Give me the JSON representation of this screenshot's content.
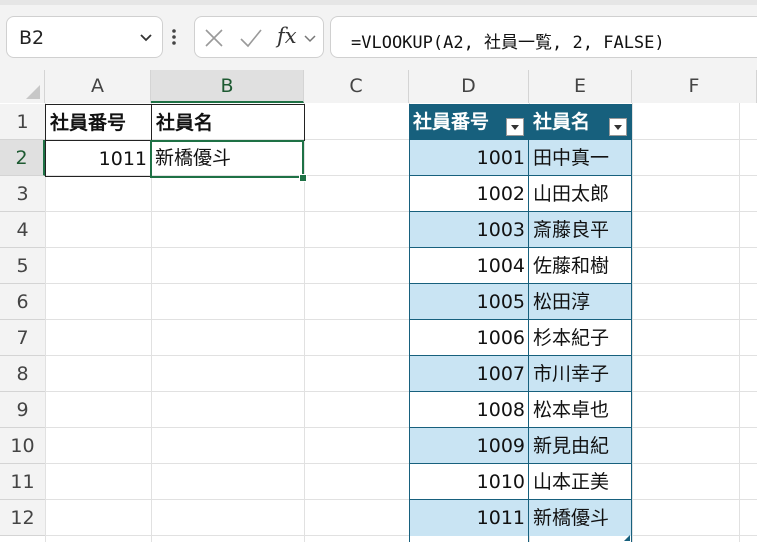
{
  "name_box": "B2",
  "formula": "=VLOOKUP(A2, 社員一覧, 2, FALSE)",
  "fx_label": "fx",
  "columns": [
    "A",
    "B",
    "C",
    "D",
    "E",
    "F"
  ],
  "rows": [
    "1",
    "2",
    "3",
    "4",
    "5",
    "6",
    "7",
    "8",
    "9",
    "10",
    "11",
    "12"
  ],
  "cells": {
    "A1": "社員番号",
    "B1": "社員名",
    "A2": "1011",
    "B2": "新橋優斗"
  },
  "table": {
    "name": "社員一覧",
    "headers": [
      "社員番号",
      "社員名"
    ],
    "rows": [
      [
        "1001",
        "田中真一"
      ],
      [
        "1002",
        "山田太郎"
      ],
      [
        "1003",
        "斎藤良平"
      ],
      [
        "1004",
        "佐藤和樹"
      ],
      [
        "1005",
        "松田淳"
      ],
      [
        "1006",
        "杉本紀子"
      ],
      [
        "1007",
        "市川幸子"
      ],
      [
        "1008",
        "松本卓也"
      ],
      [
        "1009",
        "新見由紀"
      ],
      [
        "1010",
        "山本正美"
      ],
      [
        "1011",
        "新橋優斗"
      ]
    ],
    "header_color": "#17607d",
    "band_color": "#c9e4f3"
  },
  "selection_color": "#1e7145"
}
